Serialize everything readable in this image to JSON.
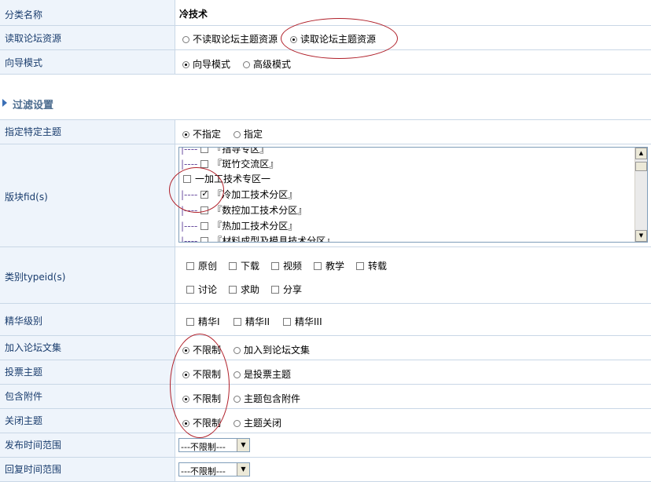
{
  "basic": {
    "category_label": "分类名称",
    "category_value": "冷技术",
    "read_forum_label": "读取论坛资源",
    "read_forum_options": [
      "不读取论坛主题资源",
      "读取论坛主题资源"
    ],
    "read_forum_selected": 1,
    "mode_label": "向导模式",
    "mode_options": [
      "向导模式",
      "高级模式"
    ],
    "mode_selected": 0
  },
  "filter": {
    "section_title": "过滤设置",
    "topic_label": "指定特定主题",
    "topic_options": [
      "不指定",
      "指定"
    ],
    "topic_selected": 0,
    "forum_label": "版块fid(s)",
    "forum_items": [
      {
        "prefix": "|---- ",
        "text": "『指导专区』",
        "checked": false
      },
      {
        "prefix": "|---- ",
        "text": "『斑竹交流区』",
        "checked": false
      },
      {
        "prefix": "",
        "text": "一加工技术专区一",
        "checked": false
      },
      {
        "prefix": "|---- ",
        "text": "『冷加工技术分区』",
        "checked": true
      },
      {
        "prefix": "|---- ",
        "text": "『数控加工技术分区』",
        "checked": false
      },
      {
        "prefix": "|---- ",
        "text": "『热加工技术分区』",
        "checked": false
      },
      {
        "prefix": "|---- ",
        "text": "『材料成型及模具技术分区』",
        "checked": false
      }
    ],
    "type_label": "类别typeid(s)",
    "type_row1": [
      "原创",
      "下载",
      "视频",
      "教学",
      "转载"
    ],
    "type_row2": [
      "讨论",
      "求助",
      "分享"
    ],
    "digest_label": "精华级别",
    "digest_options": [
      "精华I",
      "精华II",
      "精华III"
    ],
    "collect_label": "加入论坛文集",
    "collect_options": [
      "不限制",
      "加入到论坛文集"
    ],
    "poll_label": "投票主题",
    "poll_options": [
      "不限制",
      "是投票主题"
    ],
    "attach_label": "包含附件",
    "attach_options": [
      "不限制",
      "主题包含附件"
    ],
    "closed_label": "关闭主题",
    "closed_options": [
      "不限制",
      "主题关闭"
    ],
    "post_time_label": "发布时间范围",
    "post_time_value": "---不限制---",
    "reply_time_label": "回复时间范围",
    "reply_time_value": "---不限制---"
  }
}
